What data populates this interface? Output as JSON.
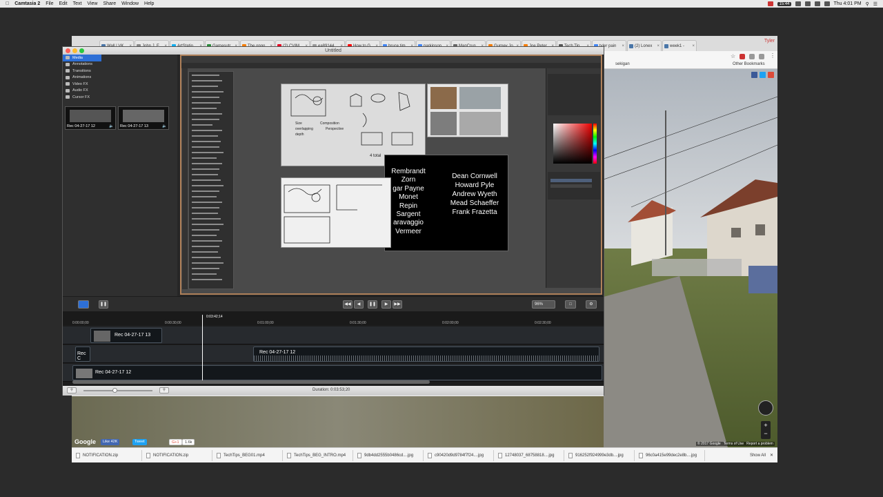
{
  "menubar": {
    "app": "Camtasia 2",
    "menus": [
      "File",
      "Edit",
      "Text",
      "View",
      "Share",
      "Window",
      "Help"
    ],
    "clock": "Thu 4:01 PM",
    "battery_badge": "15:44"
  },
  "chrome": {
    "tabs": [
      {
        "label": "Wall | VK",
        "color": "#4a76a8"
      },
      {
        "label": "John J. F",
        "color": "#888888"
      },
      {
        "label": "ArtStatio",
        "color": "#13aff0"
      },
      {
        "label": "Gamasutr",
        "color": "#2c8c3c"
      },
      {
        "label": "The ongo",
        "color": "#f57d00"
      },
      {
        "label": "(2) CVIM",
        "color": "#e60023"
      },
      {
        "label": "ea89144",
        "color": "#999999"
      },
      {
        "label": "How to G",
        "color": "#ff0000"
      },
      {
        "label": "bruce tim",
        "color": "#4285f4"
      },
      {
        "label": "parkinson",
        "color": "#4285f4"
      },
      {
        "label": "MapCrun",
        "color": "#666666"
      },
      {
        "label": "Gurney Jo",
        "color": "#f57d00"
      },
      {
        "label": "Joe Peter",
        "color": "#f57d00"
      },
      {
        "label": "Tech Tip",
        "color": "#555555"
      },
      {
        "label": "tyler pain",
        "color": "#4285f4"
      },
      {
        "label": "(2) Lonex",
        "color": "#4a76a8"
      },
      {
        "label": "week1 - ",
        "color": "#4a76a8"
      }
    ],
    "profile": "Tyler",
    "bookmark_right": "sekigan",
    "other_bookmarks": "Other Bookmarks",
    "google_label": "Google",
    "like_label": "Like 42K",
    "tweet_label": "Tweet",
    "gplus_count": "1.6k",
    "map_footer": [
      "© 2017 Google",
      "Terms of Use",
      "Report a problem"
    ],
    "downloads": [
      "NOTIFICATION.zip",
      "NOTIFICATION.zip",
      "TechTips_BEG01.mp4",
      "TechTips_BEG_INTRO.mp4",
      "9db4dd2555b0486cd....jpg",
      "c90420d9d9784f7f24....jpg",
      "12748037_68758818....jpg",
      "916252f924999e3db....jpg",
      "96c0a415e99dec2e8b....jpg"
    ],
    "show_all": "Show All"
  },
  "camtasia": {
    "title": "Untitled",
    "sidebar": [
      {
        "label": "Media",
        "selected": true
      },
      {
        "label": "Annotations",
        "selected": false
      },
      {
        "label": "Transitions",
        "selected": false
      },
      {
        "label": "Animations",
        "selected": false
      },
      {
        "label": "Video FX",
        "selected": false
      },
      {
        "label": "Audio FX",
        "selected": false
      },
      {
        "label": "Cursor FX",
        "selected": false
      }
    ],
    "media_thumbs": [
      "Rec 04-27-17 12",
      "Rec 04-27-17 13"
    ],
    "zoom": "96%",
    "playhead_time": "0:03:42;14",
    "ruler": [
      "0:00:00;00",
      "0:00:30;00",
      "0:01:00;00",
      "0:01:30;00",
      "0:02:00;00",
      "0:02:30;00"
    ],
    "clips": {
      "track3": "Rec 04-27-17 13",
      "track2_a": "Rec C",
      "track2_b": "Rec 04-27-17 12",
      "track1": "Rec 04-27-17 12"
    },
    "duration": "Duration: 0:03:53;20",
    "names_left": [
      "Rembrandt",
      "Zorn",
      "gar Payne",
      "Monet",
      "Repin",
      "Sargent",
      "aravaggio",
      "Vermeer"
    ],
    "names_right": [
      "Dean Cornwell",
      "Howard Pyle",
      "Andrew Wyeth",
      "Mead Schaeffer",
      "Frank Frazetta"
    ],
    "sketch_notes": [
      "Size",
      "overlapping",
      "depth",
      "Composition",
      "Perspective",
      "4 total"
    ]
  }
}
